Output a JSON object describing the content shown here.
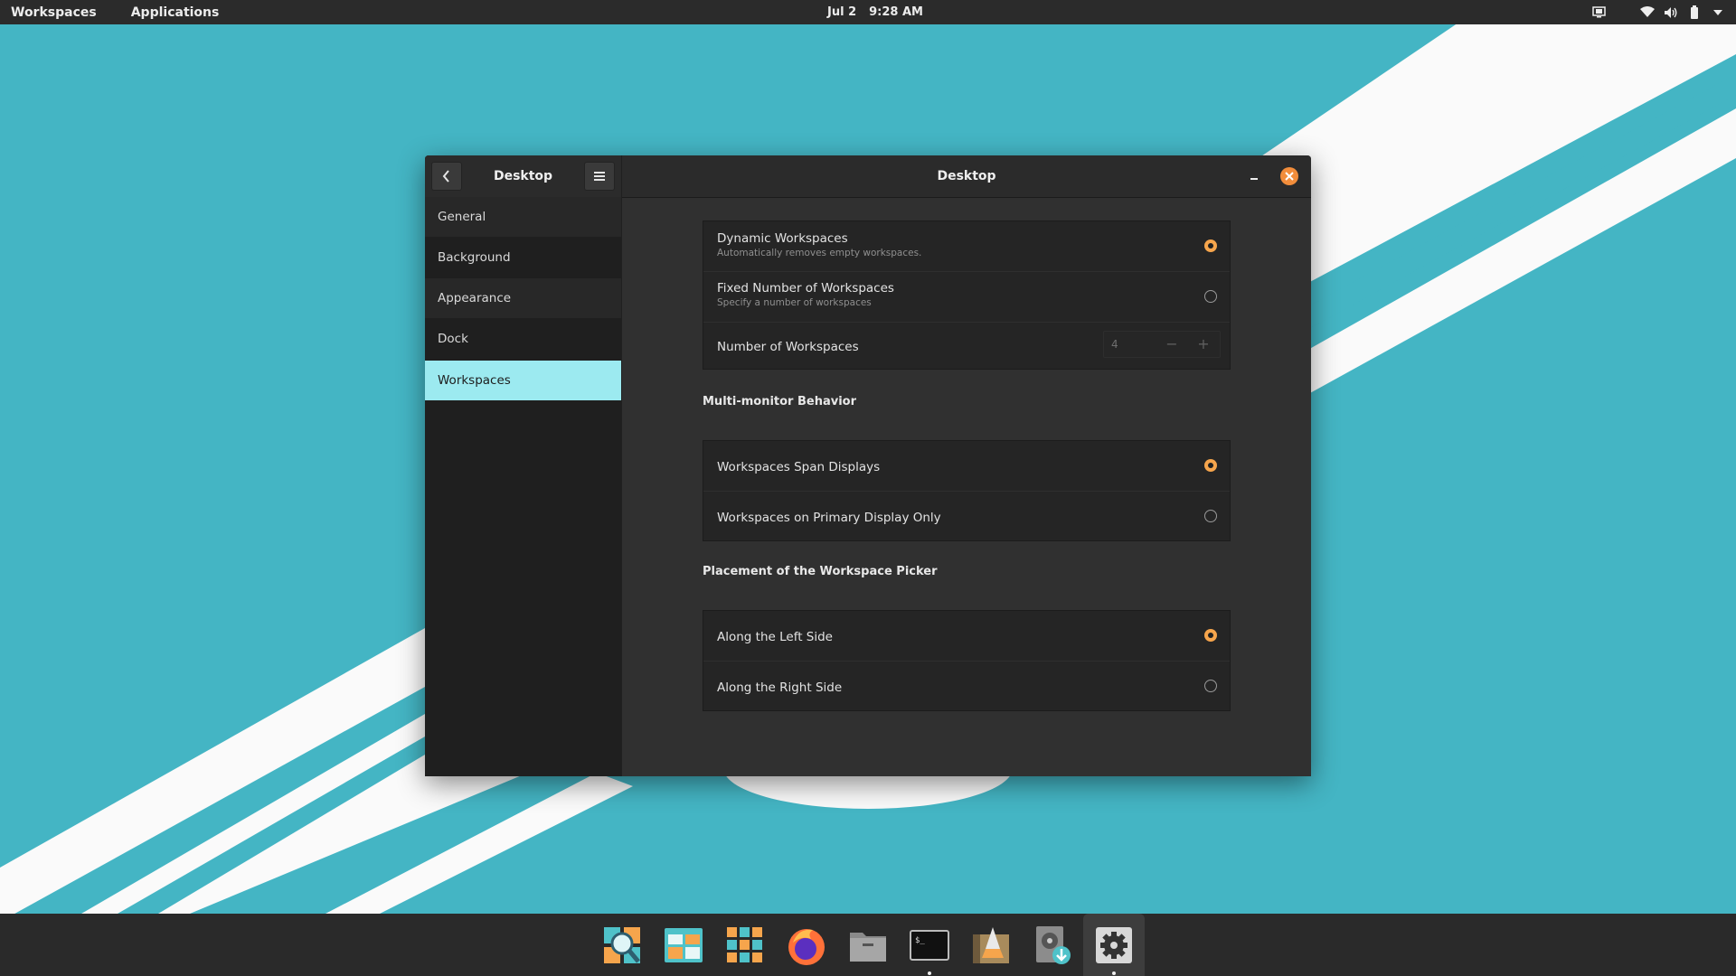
{
  "topbar": {
    "workspaces_label": "Workspaces",
    "applications_label": "Applications",
    "date": "Jul 2",
    "time": "9:28 AM",
    "tray_icons": [
      "screen-icon",
      "wifi-icon",
      "volume-icon",
      "battery-icon",
      "chevron-down-icon"
    ]
  },
  "window": {
    "sidebar_title": "Desktop",
    "content_title": "Desktop",
    "sidebar_items": [
      {
        "label": "General"
      },
      {
        "label": "Background"
      },
      {
        "label": "Appearance"
      },
      {
        "label": "Dock"
      },
      {
        "label": "Workspaces",
        "selected": true
      }
    ],
    "workspace_mode": {
      "options": [
        {
          "title": "Dynamic Workspaces",
          "subtitle": "Automatically removes empty workspaces.",
          "selected": true
        },
        {
          "title": "Fixed Number of Workspaces",
          "subtitle": "Specify a number of workspaces",
          "selected": false
        }
      ],
      "count_label": "Number of Workspaces",
      "count_value": "4",
      "count_minus": "−",
      "count_plus": "+"
    },
    "multimonitor": {
      "heading": "Multi-monitor Behavior",
      "options": [
        {
          "title": "Workspaces Span Displays",
          "selected": true
        },
        {
          "title": "Workspaces on Primary Display Only",
          "selected": false
        }
      ]
    },
    "picker": {
      "heading": "Placement of the Workspace Picker",
      "options": [
        {
          "title": "Along the Left Side",
          "selected": true
        },
        {
          "title": "Along the Right Side",
          "selected": false
        }
      ]
    }
  },
  "dock": {
    "apps": [
      {
        "name": "search-app-icon"
      },
      {
        "name": "gallery-app-icon"
      },
      {
        "name": "app-grid-icon"
      },
      {
        "name": "firefox-icon"
      },
      {
        "name": "files-icon"
      },
      {
        "name": "terminal-icon",
        "running": true
      },
      {
        "name": "pop-shop-icon"
      },
      {
        "name": "installer-icon"
      },
      {
        "name": "settings-icon",
        "running": true,
        "active": true
      }
    ]
  },
  "colors": {
    "wallpaper": "#44b5c4",
    "accent": "#f6a54c",
    "selection": "#9ceaf0",
    "close": "#f28d3b"
  }
}
